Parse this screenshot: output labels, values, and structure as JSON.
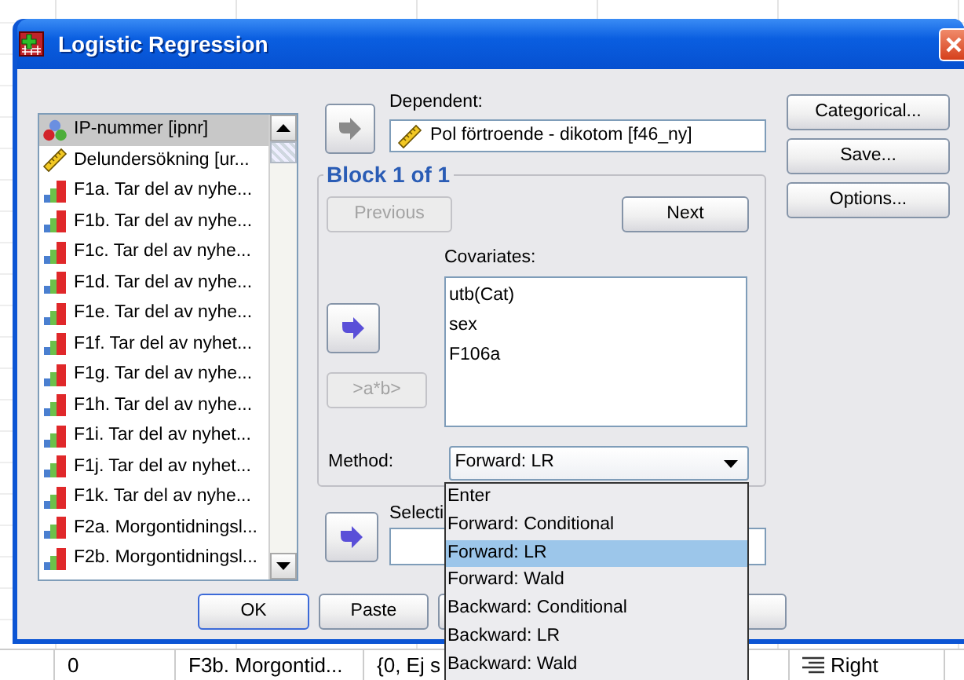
{
  "window": {
    "title": "Logistic Regression"
  },
  "variables": [
    {
      "label": "IP-nummer [ipnr]",
      "kind": "nominal",
      "selected": true
    },
    {
      "label": "Delundersökning [ur...",
      "kind": "scale",
      "selected": false
    },
    {
      "label": "F1a. Tar del av nyhe...",
      "kind": "ordinal",
      "selected": false
    },
    {
      "label": "F1b. Tar del av nyhe...",
      "kind": "ordinal",
      "selected": false
    },
    {
      "label": "F1c. Tar del av nyhe...",
      "kind": "ordinal",
      "selected": false
    },
    {
      "label": "F1d. Tar del av nyhe...",
      "kind": "ordinal",
      "selected": false
    },
    {
      "label": "F1e. Tar del av nyhe...",
      "kind": "ordinal",
      "selected": false
    },
    {
      "label": "F1f. Tar del av nyhet...",
      "kind": "ordinal",
      "selected": false
    },
    {
      "label": "F1g. Tar del av nyhe...",
      "kind": "ordinal",
      "selected": false
    },
    {
      "label": "F1h. Tar del av nyhe...",
      "kind": "ordinal",
      "selected": false
    },
    {
      "label": "F1i. Tar del av nyhet...",
      "kind": "ordinal",
      "selected": false
    },
    {
      "label": "F1j. Tar del av nyhet...",
      "kind": "ordinal",
      "selected": false
    },
    {
      "label": "F1k. Tar del av nyhe...",
      "kind": "ordinal",
      "selected": false
    },
    {
      "label": "F2a. Morgontidningsl...",
      "kind": "ordinal",
      "selected": false
    },
    {
      "label": "F2b. Morgontidningsl...",
      "kind": "ordinal",
      "selected": false
    }
  ],
  "dependent": {
    "label": "Dependent:",
    "value": "Pol förtroende - dikotom [f46_ny]",
    "kind": "scale",
    "move_disabled": true
  },
  "block": {
    "title": "Block 1 of 1",
    "previous": {
      "label": "Previous",
      "disabled": true
    },
    "next": {
      "label": "Next",
      "disabled": false
    },
    "move_disabled": false,
    "covariates_label": "Covariates:",
    "covariates": [
      "utb(Cat)",
      "sex",
      "F106a"
    ],
    "interaction": {
      "label": ">a*b>",
      "disabled": true
    }
  },
  "method": {
    "label": "Method:",
    "value": "Forward: LR",
    "options": [
      {
        "label": "Enter",
        "selected": false
      },
      {
        "label": "Forward: Conditional",
        "selected": false
      },
      {
        "label": "Forward: LR",
        "selected": true
      },
      {
        "label": "Forward: Wald",
        "selected": false
      },
      {
        "label": "Backward: Conditional",
        "selected": false
      },
      {
        "label": "Backward: LR",
        "selected": false
      },
      {
        "label": "Backward: Wald",
        "selected": false
      }
    ]
  },
  "selection": {
    "label": "Selecti",
    "move_disabled": false
  },
  "side_buttons": [
    "Categorical...",
    "Save...",
    "Options..."
  ],
  "buttons": [
    "OK",
    "Paste"
  ],
  "background_row": {
    "cells": [
      "0",
      "F3b. Morgontid...",
      "{0, Ej s"
    ],
    "alignment": "Right"
  }
}
